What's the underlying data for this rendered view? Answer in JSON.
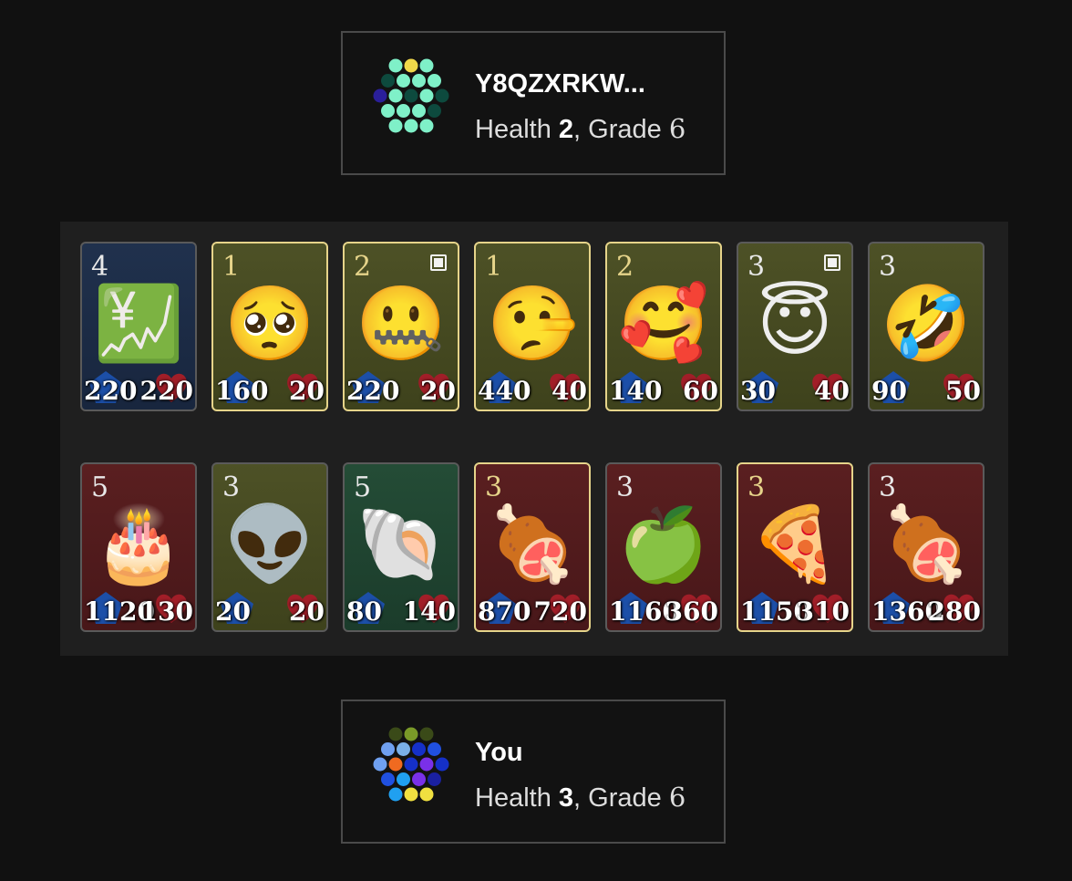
{
  "opponent": {
    "name": "Y8QZXRKW...",
    "health_label": "Health",
    "health": "2",
    "separator": ",",
    "grade_label": "Grade",
    "grade": "6",
    "avatar_dots": [
      "#7ff0c8",
      "#f0d84a",
      "#7ff0c8",
      "#0d4a3e",
      "#7ff0c8",
      "#7ff0c8",
      "#7ff0c8",
      "#2a1f9a",
      "#7ff0c8",
      "#0d4a3e",
      "#7ff0c8",
      "#0d4a3e",
      "#7ff0c8",
      "#7ff0c8",
      "#7ff0c8",
      "#0d4a3e",
      "#7ff0c8",
      "#7ff0c8",
      "#7ff0c8"
    ]
  },
  "player": {
    "name": "You",
    "health_label": "Health",
    "health": "3",
    "separator": ",",
    "grade_label": "Grade",
    "grade": "6",
    "avatar_dots": [
      "#3a4a18",
      "#7a9a28",
      "#3a4a18",
      "#6fa0f0",
      "#7ab0e8",
      "#1530c8",
      "#2050e0",
      "#6fa0f0",
      "#f06a20",
      "#1530c8",
      "#7a30e8",
      "#1530c8",
      "#2050e0",
      "#20a0f0",
      "#7a30e8",
      "#1a20a0",
      "#20a0f0",
      "#f0e040",
      "#f0e040"
    ]
  },
  "colors": {
    "attack_icon": "#1c4fa8",
    "health_icon": "#a11e28",
    "gold_border": "#e6d48a"
  },
  "board": {
    "rows": [
      [
        {
          "tier": "4",
          "emoji": "💹",
          "icon": "chart-increasing-yen-icon",
          "attack": "220",
          "health": "220",
          "bg": "navy",
          "gold": false,
          "marked": false
        },
        {
          "tier": "1",
          "emoji": "🥺",
          "icon": "pleading-face-icon",
          "attack": "160",
          "health": "20",
          "bg": "olive",
          "gold": true,
          "marked": false
        },
        {
          "tier": "2",
          "emoji": "🤐",
          "icon": "zipper-mouth-face-icon",
          "attack": "220",
          "health": "20",
          "bg": "olive",
          "gold": true,
          "marked": true
        },
        {
          "tier": "1",
          "emoji": "🤥",
          "icon": "lying-face-icon",
          "attack": "440",
          "health": "40",
          "bg": "olive",
          "gold": true,
          "marked": false
        },
        {
          "tier": "2",
          "emoji": "🥰",
          "icon": "smiling-face-with-hearts-icon",
          "attack": "140",
          "health": "60",
          "bg": "olive",
          "gold": true,
          "marked": false
        },
        {
          "tier": "3",
          "emoji": "😇",
          "icon": "smiling-face-with-halo-icon",
          "attack": "30",
          "health": "40",
          "bg": "olive",
          "gold": false,
          "marked": true
        },
        {
          "tier": "3",
          "emoji": "🤣",
          "icon": "rolling-on-floor-laughing-icon",
          "attack": "90",
          "health": "50",
          "bg": "olive",
          "gold": false,
          "marked": false
        }
      ],
      [
        {
          "tier": "5",
          "emoji": "🎂",
          "icon": "birthday-cake-icon",
          "attack": "1120",
          "health": "130",
          "bg": "maroon",
          "gold": false,
          "marked": false
        },
        {
          "tier": "3",
          "emoji": "👽",
          "icon": "alien-icon",
          "attack": "20",
          "health": "20",
          "bg": "olive",
          "gold": false,
          "marked": false
        },
        {
          "tier": "5",
          "emoji": "🐚",
          "icon": "spiral-shell-icon",
          "attack": "80",
          "health": "140",
          "bg": "green",
          "gold": false,
          "marked": false
        },
        {
          "tier": "3",
          "emoji": "🍖",
          "icon": "meat-on-bone-icon",
          "attack": "870",
          "health": "720",
          "bg": "maroon",
          "gold": true,
          "marked": false
        },
        {
          "tier": "3",
          "emoji": "🍏",
          "icon": "green-apple-icon",
          "attack": "1160",
          "health": "360",
          "bg": "maroon",
          "gold": false,
          "marked": false
        },
        {
          "tier": "3",
          "emoji": "🍕",
          "icon": "pizza-icon",
          "attack": "1150",
          "health": "310",
          "bg": "maroon",
          "gold": true,
          "marked": false
        },
        {
          "tier": "3",
          "emoji": "🍖",
          "icon": "meat-on-bone-icon",
          "attack": "1360",
          "health": "280",
          "bg": "maroon",
          "gold": false,
          "marked": false
        }
      ]
    ]
  }
}
